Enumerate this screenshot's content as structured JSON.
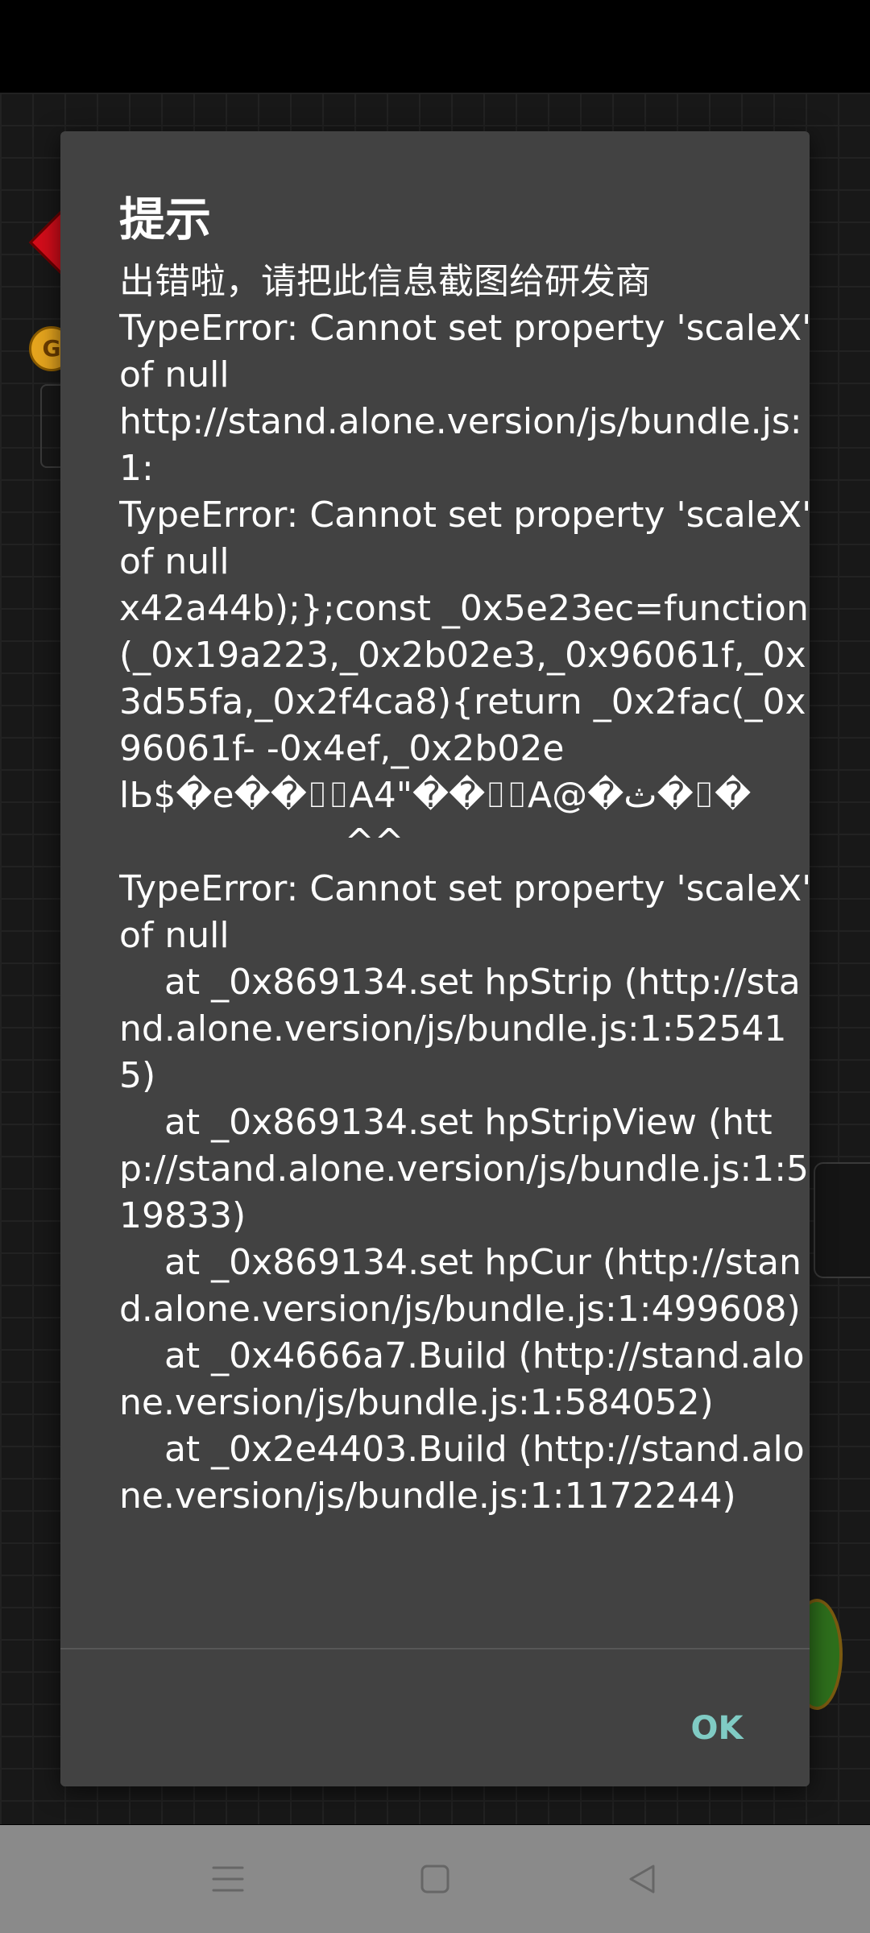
{
  "background": {
    "coin_label": "G"
  },
  "dialog": {
    "title": "提示",
    "message": "出错啦，请把此信息截图给研发商\nTypeError: Cannot set property 'scaleX' of null\nhttp://stand.alone.version/js/bundle.js:1:\nTypeError: Cannot set property 'scaleX' of null\nx42a44b);};const _0x5e23ec=function(_0x19a223,_0x2b02e3,_0x96061f,_0x3d55fa,_0x2f4ca8){return _0x2fac(_0x96061f- -0x4ef,_0x2b02e\nlЬ$�e��⌷⌷A4\"��⌷⌷A@�ث�⌷�\n                    ^^\nTypeError: Cannot set property 'scaleX' of null\n    at _0x869134.set hpStrip (http://stand.alone.version/js/bundle.js:1:525415)\n    at _0x869134.set hpStripView (http://stand.alone.version/js/bundle.js:1:519833)\n    at _0x869134.set hpCur (http://stand.alone.version/js/bundle.js:1:499608)\n    at _0x4666a7.Build (http://stand.alone.version/js/bundle.js:1:584052)\n    at _0x2e4403.Build (http://stand.alone.version/js/bundle.js:1:1172244)",
    "ok_label": "OK"
  },
  "navigation": {
    "menu_icon": "menu-icon",
    "home_icon": "home-square-icon",
    "back_icon": "back-triangle-icon"
  },
  "colors": {
    "dialog_background": "#424242",
    "ok_accent": "#80cbc4",
    "nav_bar": "#8a8a8a"
  }
}
